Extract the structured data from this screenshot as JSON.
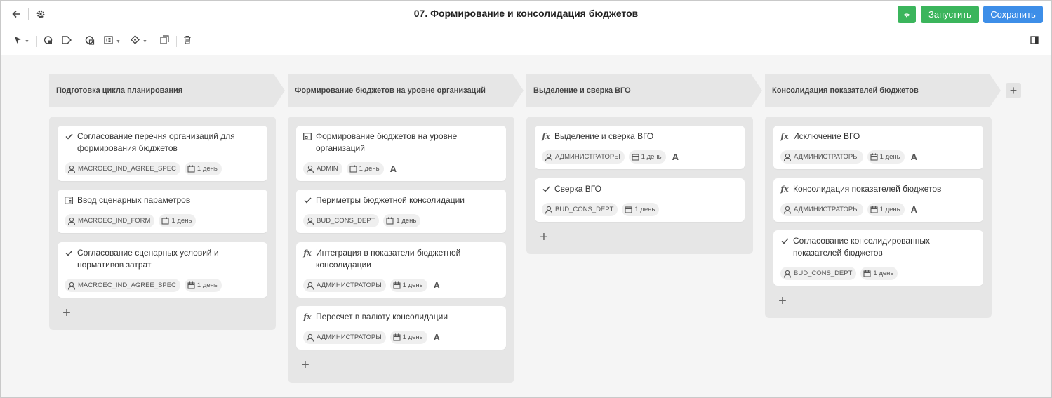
{
  "header": {
    "title": "07. Формирование и консолидация бюджетов",
    "run_label": "Запустить",
    "save_label": "Сохранить"
  },
  "toolbar": {
    "icons": [
      "pointer-icon",
      "gateway-icon",
      "label-icon",
      "connector-icon",
      "form-icon",
      "diamond-icon",
      "copy-icon",
      "delete-icon",
      "panel-toggle-icon"
    ]
  },
  "colors": {
    "green": "#3bb55c",
    "blue": "#3d8ee8",
    "lane": "#e6e6e6"
  },
  "stages": [
    {
      "title": "Подготовка цикла планирования",
      "cards": [
        {
          "icon": "check-icon",
          "title": "Согласование перечня организаций для формирования бюджетов",
          "role": "MACROEC_IND_AGREE_SPEC",
          "duration": "1 день",
          "auto": ""
        },
        {
          "icon": "form-icon",
          "title": "Ввод сценарных параметров",
          "role": "MACROEC_IND_FORM",
          "duration": "1 день",
          "auto": ""
        },
        {
          "icon": "check-icon",
          "title": "Согласование сценарных условий и нормативов затрат",
          "role": "MACROEC_IND_AGREE_SPEC",
          "duration": "1 день",
          "auto": ""
        }
      ]
    },
    {
      "title": "Формирование бюджетов на уровне организаций",
      "cards": [
        {
          "icon": "input-form-icon",
          "title": "Формирование бюджетов на уровне организаций",
          "role": "ADMIN",
          "duration": "1 день",
          "auto": "A"
        },
        {
          "icon": "check-icon",
          "title": "Периметры бюджетной консолидации",
          "role": "BUD_CONS_DEPT",
          "duration": "1 день",
          "auto": ""
        },
        {
          "icon": "function-icon",
          "title": "Интеграция в показатели бюджетной консолидации",
          "role": "АДМИНИСТРАТОРЫ",
          "duration": "1 день",
          "auto": "A"
        },
        {
          "icon": "function-icon",
          "title": "Пересчет в валюту консолидации",
          "role": "АДМИНИСТРАТОРЫ",
          "duration": "1 день",
          "auto": "A"
        }
      ]
    },
    {
      "title": "Выделение и сверка ВГО",
      "cards": [
        {
          "icon": "function-icon",
          "title": "Выделение и сверка ВГО",
          "role": "АДМИНИСТРАТОРЫ",
          "duration": "1 день",
          "auto": "A"
        },
        {
          "icon": "check-icon",
          "title": "Сверка ВГО",
          "role": "BUD_CONS_DEPT",
          "duration": "1 день",
          "auto": ""
        }
      ]
    },
    {
      "title": "Консолидация показателей бюджетов",
      "cards": [
        {
          "icon": "function-icon",
          "title": "Исключение ВГО",
          "role": "АДМИНИСТРАТОРЫ",
          "duration": "1 день",
          "auto": "A"
        },
        {
          "icon": "function-icon",
          "title": "Консолидация показателей бюджетов",
          "role": "АДМИНИСТРАТОРЫ",
          "duration": "1 день",
          "auto": "A"
        },
        {
          "icon": "check-icon",
          "title": "Согласование консолидированных показателей бюджетов",
          "role": "BUD_CONS_DEPT",
          "duration": "1 день",
          "auto": ""
        }
      ]
    }
  ]
}
